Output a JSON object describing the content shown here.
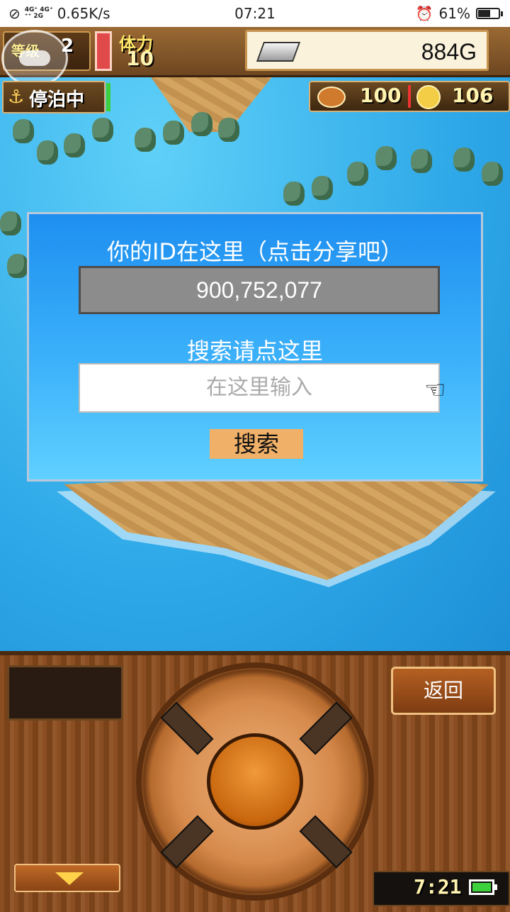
{
  "status_bar": {
    "network_top": "4G⁺ 4G⁺",
    "network_bottom": "⁺⁺ 2G",
    "speed": "0.65K/s",
    "time": "07:21",
    "battery_percent": "61%",
    "battery_level": 0.61
  },
  "hud": {
    "level_label": "等级",
    "level_value": "2",
    "stamina_label": "体力",
    "stamina_value": "10",
    "gold": "884G",
    "moored_label": "停泊中",
    "food_value": "100",
    "coin_value": "106"
  },
  "dialog": {
    "title": "你的ID在这里（点击分享吧）",
    "id_value": "900,752,077",
    "search_label": "搜索请点这里",
    "search_placeholder": "在这里输入",
    "search_button": "搜索"
  },
  "console": {
    "back_button": "返回",
    "clock": "7:21"
  },
  "colors": {
    "dialog_top": "#1e8ff0",
    "dialog_bottom": "#5fd0ff",
    "search_button": "#f0b068",
    "wood": "#8a4e22"
  }
}
